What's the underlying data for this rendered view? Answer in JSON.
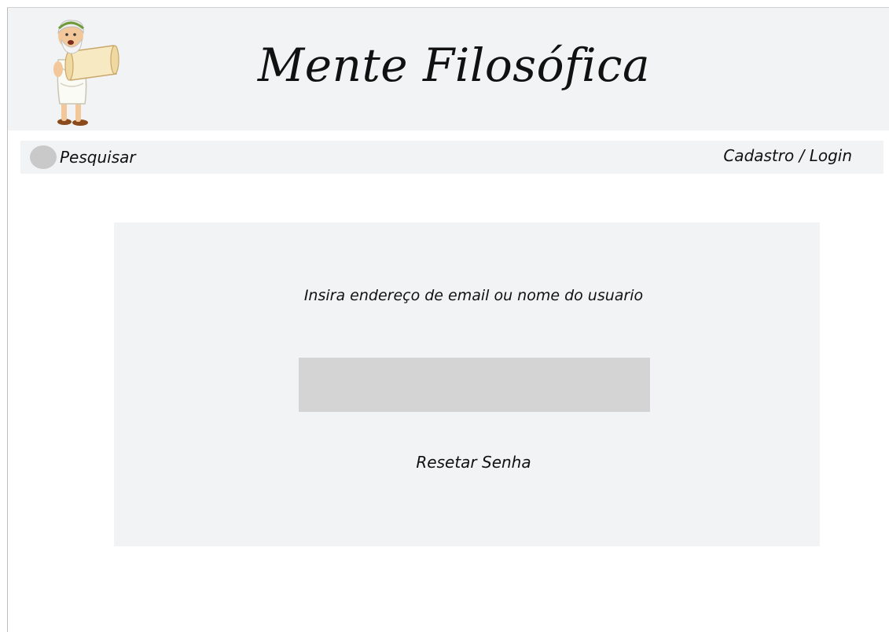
{
  "header": {
    "title": "Mente Filosófica",
    "logo_icon": "philosopher-mascot-icon"
  },
  "nav": {
    "search_label": "Pesquisar",
    "search_icon": "search-circle-icon",
    "auth_link": "Cadastro / Login"
  },
  "reset_form": {
    "prompt": "Insira endereço de email ou nome do usuario",
    "input_value": "",
    "input_placeholder": "",
    "submit_label": "Resetar Senha"
  },
  "colors": {
    "panel_background": "#f2f3f4",
    "input_background": "#d4d4d4",
    "search_circle": "#c9c9c9",
    "text": "#111111"
  }
}
